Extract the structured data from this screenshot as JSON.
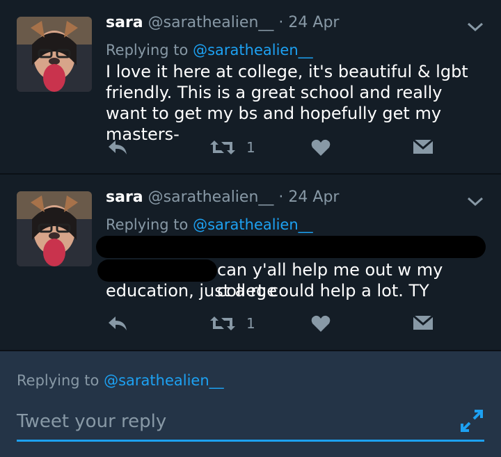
{
  "tweets": [
    {
      "name": "sara",
      "handle": "@sarathealien__",
      "separator": "·",
      "date": "24 Apr",
      "replying_prefix": "Replying to",
      "replying_to": "@sarathealien__",
      "body": "I love it here at college, it's beautiful & lgbt friendly. This is a great school and really want to get my bs and hopefully get my masters-",
      "retweet_count": "1"
    },
    {
      "name": "sara",
      "handle": "@sarathealien__",
      "separator": "·",
      "date": "24 Apr",
      "replying_prefix": "Replying to",
      "replying_to": "@sarathealien__",
      "body_visible_line1": "can y'all help me out w my college",
      "body_visible_line2": "education, just a rt could help a lot. TY",
      "retweet_count": "1"
    }
  ],
  "composer": {
    "replying_prefix": "Replying to",
    "replying_to": "@sarathealien__",
    "placeholder": "Tweet your reply"
  },
  "icons": [
    "chevron-down-icon",
    "reply-icon",
    "retweet-icon",
    "like-icon",
    "direct-message-icon",
    "expand-icon"
  ],
  "colors": {
    "background": "#141d26",
    "accent": "#1da1f2",
    "muted": "#8899a6",
    "composer": "#243447"
  }
}
